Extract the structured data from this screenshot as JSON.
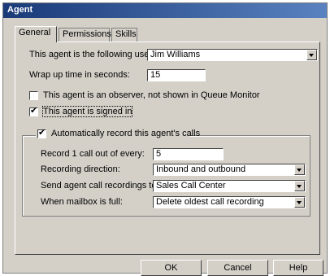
{
  "window": {
    "title": "Agent"
  },
  "tabs": [
    {
      "label": "General",
      "active": true
    },
    {
      "label": "Permissions",
      "active": false
    },
    {
      "label": "Skills",
      "active": false
    }
  ],
  "general": {
    "user_label": "This agent is the following user:",
    "user_value": "Jim Williams",
    "wrapup_label": "Wrap up time in seconds:",
    "wrapup_value": "15",
    "observer_label": "This agent is an observer, not shown in Queue Monitor",
    "observer_checked": false,
    "signed_in_label": "This agent is signed in",
    "signed_in_checked": true
  },
  "recording": {
    "group_label": "Automatically record this agent's calls",
    "enabled": true,
    "record_every_label": "Record 1 call out of every:",
    "record_every_value": "5",
    "direction_label": "Recording direction:",
    "direction_value": "Inbound and outbound",
    "send_to_label": "Send agent call recordings to:",
    "send_to_value": "Sales Call Center",
    "mailbox_full_label": "When mailbox is full:",
    "mailbox_full_value": "Delete oldest call recording"
  },
  "buttons": {
    "ok": "OK",
    "cancel": "Cancel",
    "help": "Help"
  },
  "colors": {
    "dialog_bg": "#d4d0c8",
    "title_bar": "#1a3a78"
  }
}
